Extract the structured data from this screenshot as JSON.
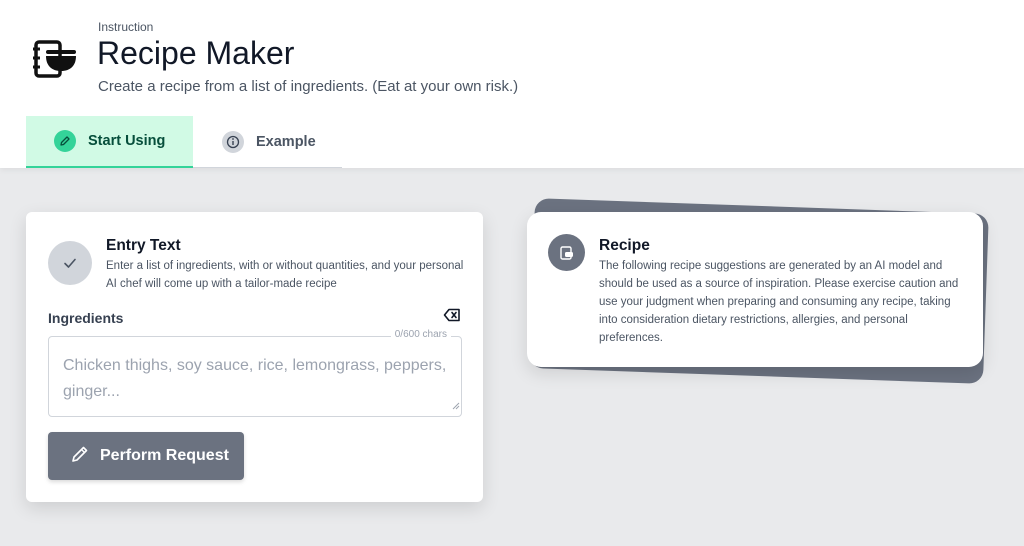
{
  "header": {
    "kicker": "Instruction",
    "title": "Recipe Maker",
    "subtitle": "Create a recipe from a list of ingredients. (Eat at your own risk.)",
    "app_icon": "bowl-book-icon"
  },
  "tabs": [
    {
      "label": "Start Using",
      "icon": "pencil-icon",
      "active": true
    },
    {
      "label": "Example",
      "icon": "info-icon",
      "active": false
    }
  ],
  "entry": {
    "title": "Entry Text",
    "description": "Enter a list of ingredients, with or without quantities, and your personal AI chef will come up with a tailor-made recipe",
    "field_label": "Ingredients",
    "placeholder": "Chicken thighs, soy sauce, rice, lemongrass, peppers, ginger...",
    "value": "",
    "char_count": "0/600 chars",
    "button_label": "Perform Request",
    "icon": "check-icon"
  },
  "recipe": {
    "title": "Recipe",
    "description": "The following recipe suggestions are generated by an AI model and should be used as a source of inspiration. Please exercise caution and use your judgment when preparing and consuming any recipe, taking into consideration dietary restrictions, allergies, and personal preferences.",
    "icon": "recipe-output-icon"
  },
  "colors": {
    "accent_green": "#34d399",
    "active_tab_bg": "#d1fae5",
    "button_gray": "#6b7280",
    "page_bg": "#e9eaec"
  }
}
